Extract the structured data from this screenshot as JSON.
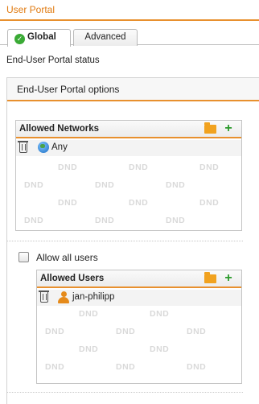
{
  "window": {
    "title": "User Portal"
  },
  "tabs": [
    {
      "label": "Global",
      "active": true
    },
    {
      "label": "Advanced",
      "active": false
    }
  ],
  "status": {
    "label": "End-User Portal status"
  },
  "options": {
    "title": "End-User Portal options",
    "allowed_networks": {
      "header": "Allowed Networks",
      "items": [
        {
          "name": "Any",
          "icon": "globe-icon"
        }
      ],
      "placeholder": "DND"
    },
    "allow_all_users": {
      "label": "Allow all users",
      "checked": false
    },
    "allowed_users": {
      "header": "Allowed Users",
      "items": [
        {
          "name": "jan-philipp",
          "icon": "user-icon"
        }
      ],
      "placeholder": "DND"
    }
  },
  "colors": {
    "accent": "#e8902e",
    "title": "#e07a10",
    "add_green": "#2a9a2a",
    "folder": "#f1a21f"
  }
}
